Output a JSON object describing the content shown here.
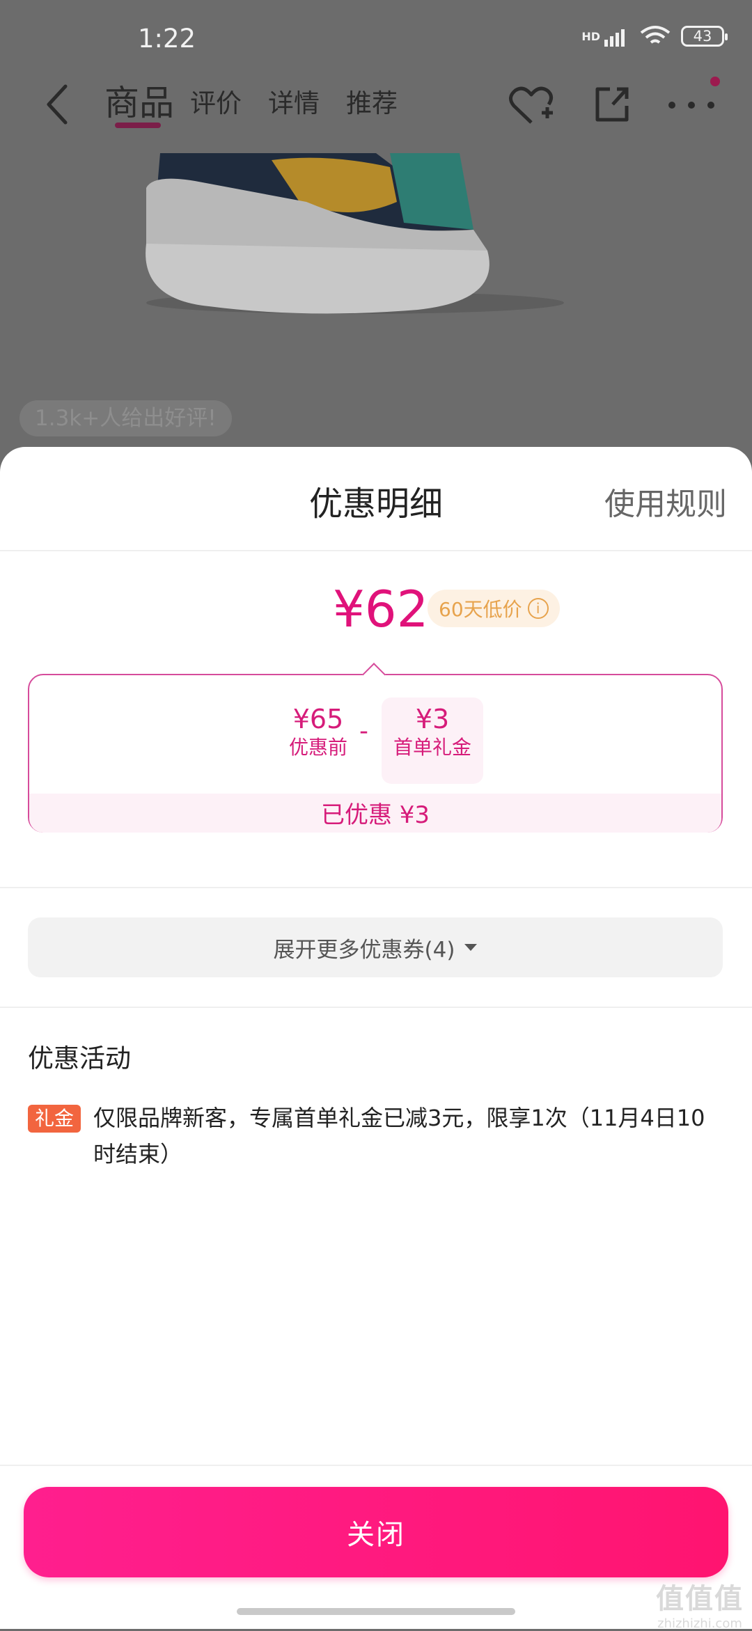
{
  "status_bar": {
    "time": "1:22",
    "network": "HD",
    "battery": "43"
  },
  "nav": {
    "tabs": [
      "商品",
      "评价",
      "详情",
      "推荐"
    ],
    "active_tab": "商品"
  },
  "product": {
    "rating_pill": "1.3k+人给出好评!"
  },
  "sheet": {
    "title": "优惠明细",
    "rules_link": "使用规则",
    "final_price": "¥62",
    "low_price_badge": "60天低价",
    "calc": {
      "original_amount": "¥65",
      "original_label": "优惠前",
      "minus": "-",
      "gift_amount": "¥3",
      "gift_label": "首单礼金",
      "saved_text": "已优惠 ¥3"
    },
    "expand_button": "展开更多优惠券(4)",
    "activity": {
      "title": "优惠活动",
      "tag": "礼金",
      "text": "仅限品牌新客，专属首单礼金已减3元，限享1次（11月4日10时结束）"
    },
    "close_button": "关闭"
  },
  "watermark": {
    "brand": "值值值",
    "site": "zhizhizhi.com"
  },
  "colors": {
    "accent": "#e0127a",
    "close_button": "#ff1a80",
    "badge_orange": "#e7a34d",
    "tag_orange": "#f2653f"
  }
}
